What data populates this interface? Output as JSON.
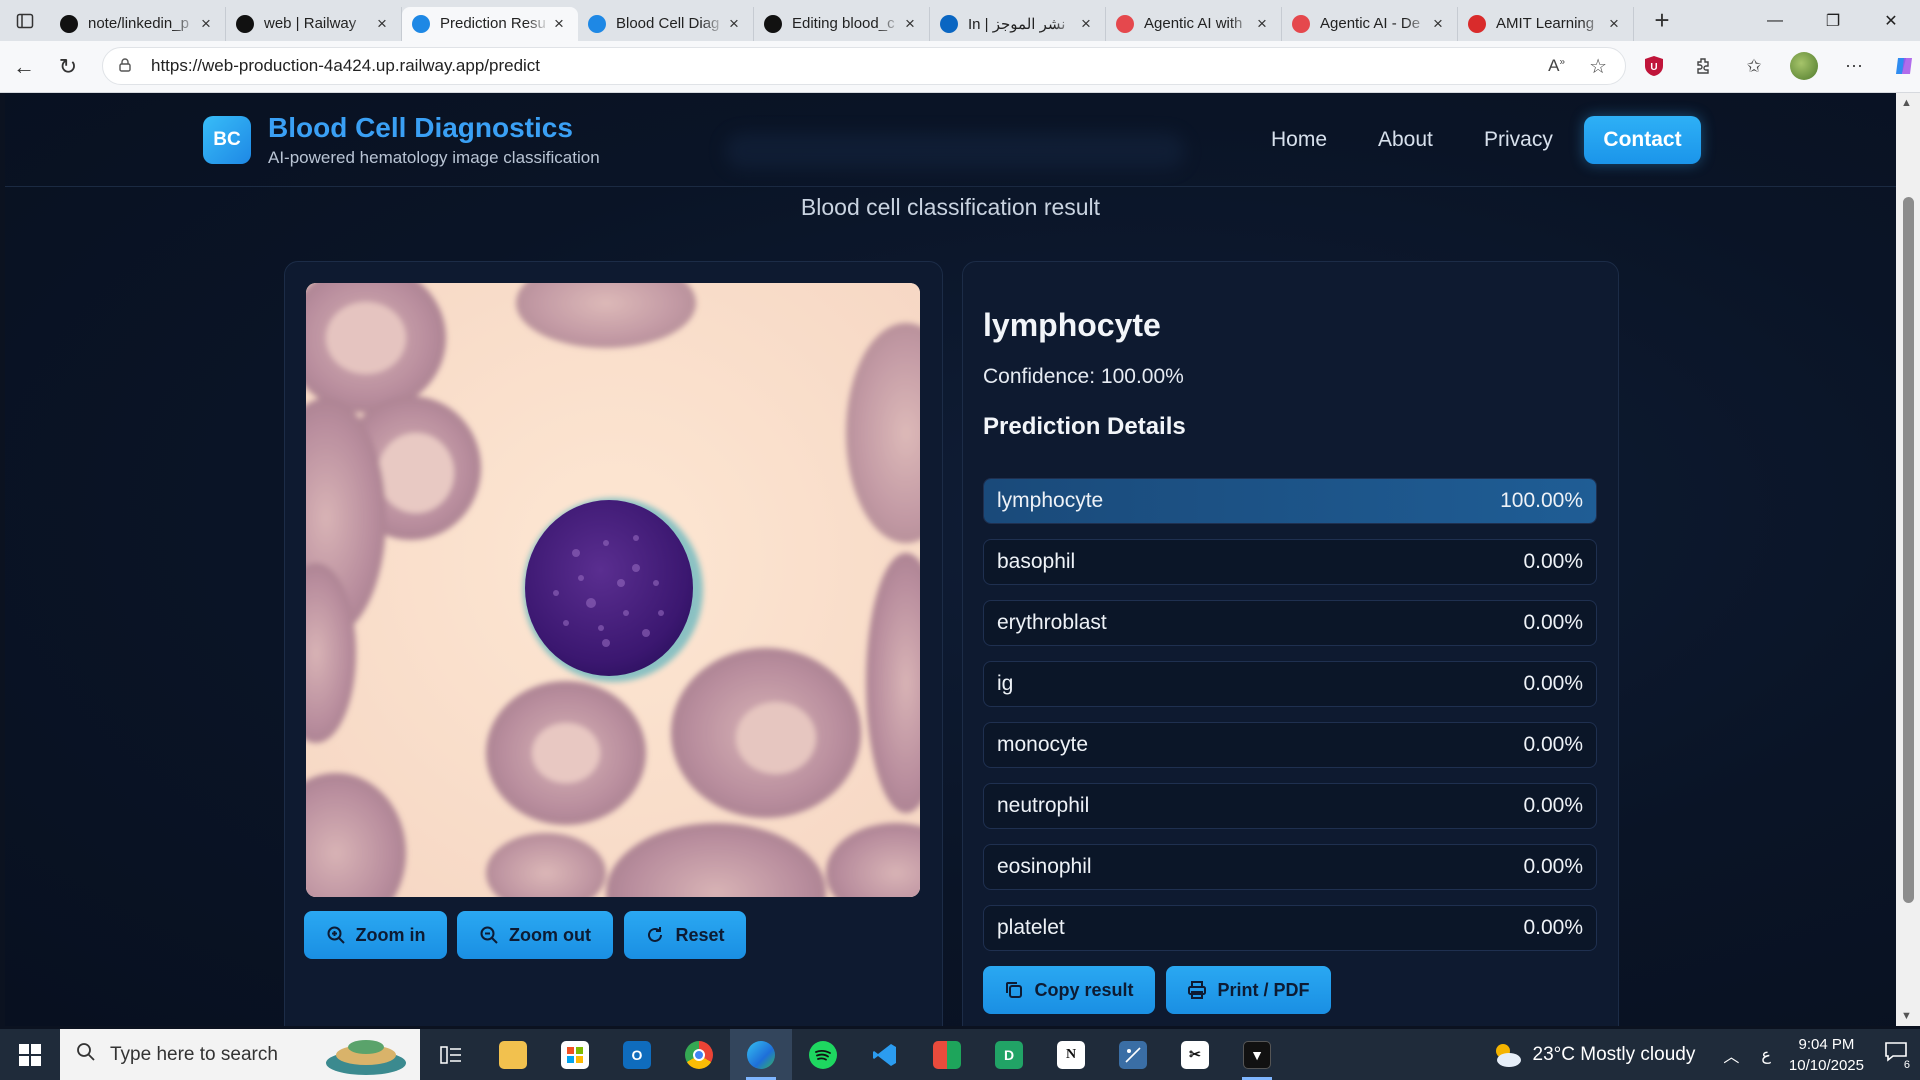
{
  "browser": {
    "tabs": [
      {
        "title": "note/linkedin_p",
        "icon": "github-icon",
        "color": "#111"
      },
      {
        "title": "web | Railway",
        "icon": "railway-icon",
        "color": "#111"
      },
      {
        "title": "Prediction Resu",
        "icon": "bc-icon",
        "color": "#1e88e5",
        "active": true
      },
      {
        "title": "Blood Cell Diag",
        "icon": "bc-icon",
        "color": "#1e88e5"
      },
      {
        "title": "Editing blood_c",
        "icon": "github-icon",
        "color": "#111"
      },
      {
        "title": "In | نشر الموجز",
        "icon": "linkedin-icon",
        "color": "#0a66c2"
      },
      {
        "title": "Agentic AI with",
        "icon": "agentic-icon",
        "color": "#e5484d"
      },
      {
        "title": "Agentic AI - De",
        "icon": "agentic-icon",
        "color": "#e5484d"
      },
      {
        "title": "AMIT Learning",
        "icon": "amit-icon",
        "color": "#d92b2b"
      }
    ],
    "url": "https://web-production-4a424.up.railway.app/predict"
  },
  "site": {
    "logo_text": "BC",
    "title": "Blood Cell Diagnostics",
    "subtitle": "AI-powered hematology image classification",
    "nav": [
      "Home",
      "About",
      "Privacy"
    ],
    "contact_label": "Contact",
    "result_heading": "Blood cell classification result"
  },
  "image_controls": {
    "zoom_in": "Zoom in",
    "zoom_out": "Zoom out",
    "reset": "Reset"
  },
  "result": {
    "label": "lymphocyte",
    "confidence_text": "Confidence: 100.00%",
    "details_title": "Prediction Details",
    "predictions": [
      {
        "label": "lymphocyte",
        "value": "100.00%",
        "fraction": 1.0
      },
      {
        "label": "basophil",
        "value": "0.00%",
        "fraction": 0
      },
      {
        "label": "erythroblast",
        "value": "0.00%",
        "fraction": 0
      },
      {
        "label": "ig",
        "value": "0.00%",
        "fraction": 0
      },
      {
        "label": "monocyte",
        "value": "0.00%",
        "fraction": 0
      },
      {
        "label": "neutrophil",
        "value": "0.00%",
        "fraction": 0
      },
      {
        "label": "eosinophil",
        "value": "0.00%",
        "fraction": 0
      },
      {
        "label": "platelet",
        "value": "0.00%",
        "fraction": 0
      }
    ],
    "copy_label": "Copy result",
    "print_label": "Print / PDF"
  },
  "taskbar": {
    "search_placeholder": "Type here to search",
    "weather": "23°C  Mostly cloudy",
    "lang": "ع",
    "time": "9:04 PM",
    "date": "10/10/2025",
    "notifications": "6"
  },
  "colors": {
    "accent": "#1e9ef0",
    "page_bg": "#0a1426",
    "card_bg": "#0e1a30"
  }
}
